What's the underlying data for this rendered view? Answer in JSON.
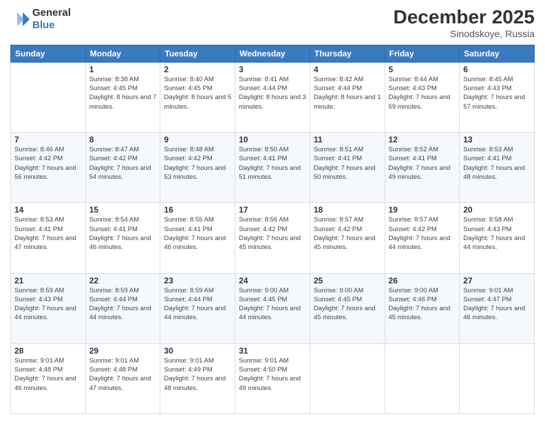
{
  "logo": {
    "general": "General",
    "blue": "Blue"
  },
  "title": "December 2025",
  "location": "Sinodskoye, Russia",
  "weekdays": [
    "Sunday",
    "Monday",
    "Tuesday",
    "Wednesday",
    "Thursday",
    "Friday",
    "Saturday"
  ],
  "weeks": [
    [
      {
        "day": "",
        "sunrise": "",
        "sunset": "",
        "daylight": ""
      },
      {
        "day": "1",
        "sunrise": "Sunrise: 8:38 AM",
        "sunset": "Sunset: 4:45 PM",
        "daylight": "Daylight: 8 hours and 7 minutes."
      },
      {
        "day": "2",
        "sunrise": "Sunrise: 8:40 AM",
        "sunset": "Sunset: 4:45 PM",
        "daylight": "Daylight: 8 hours and 5 minutes."
      },
      {
        "day": "3",
        "sunrise": "Sunrise: 8:41 AM",
        "sunset": "Sunset: 4:44 PM",
        "daylight": "Daylight: 8 hours and 3 minutes."
      },
      {
        "day": "4",
        "sunrise": "Sunrise: 8:42 AM",
        "sunset": "Sunset: 4:44 PM",
        "daylight": "Daylight: 8 hours and 1 minute."
      },
      {
        "day": "5",
        "sunrise": "Sunrise: 8:44 AM",
        "sunset": "Sunset: 4:43 PM",
        "daylight": "Daylight: 7 hours and 59 minutes."
      },
      {
        "day": "6",
        "sunrise": "Sunrise: 8:45 AM",
        "sunset": "Sunset: 4:43 PM",
        "daylight": "Daylight: 7 hours and 57 minutes."
      }
    ],
    [
      {
        "day": "7",
        "sunrise": "Sunrise: 8:46 AM",
        "sunset": "Sunset: 4:42 PM",
        "daylight": "Daylight: 7 hours and 56 minutes."
      },
      {
        "day": "8",
        "sunrise": "Sunrise: 8:47 AM",
        "sunset": "Sunset: 4:42 PM",
        "daylight": "Daylight: 7 hours and 54 minutes."
      },
      {
        "day": "9",
        "sunrise": "Sunrise: 8:48 AM",
        "sunset": "Sunset: 4:42 PM",
        "daylight": "Daylight: 7 hours and 53 minutes."
      },
      {
        "day": "10",
        "sunrise": "Sunrise: 8:50 AM",
        "sunset": "Sunset: 4:41 PM",
        "daylight": "Daylight: 7 hours and 51 minutes."
      },
      {
        "day": "11",
        "sunrise": "Sunrise: 8:51 AM",
        "sunset": "Sunset: 4:41 PM",
        "daylight": "Daylight: 7 hours and 50 minutes."
      },
      {
        "day": "12",
        "sunrise": "Sunrise: 8:52 AM",
        "sunset": "Sunset: 4:41 PM",
        "daylight": "Daylight: 7 hours and 49 minutes."
      },
      {
        "day": "13",
        "sunrise": "Sunrise: 8:53 AM",
        "sunset": "Sunset: 4:41 PM",
        "daylight": "Daylight: 7 hours and 48 minutes."
      }
    ],
    [
      {
        "day": "14",
        "sunrise": "Sunrise: 8:53 AM",
        "sunset": "Sunset: 4:41 PM",
        "daylight": "Daylight: 7 hours and 47 minutes."
      },
      {
        "day": "15",
        "sunrise": "Sunrise: 8:54 AM",
        "sunset": "Sunset: 4:41 PM",
        "daylight": "Daylight: 7 hours and 46 minutes."
      },
      {
        "day": "16",
        "sunrise": "Sunrise: 8:55 AM",
        "sunset": "Sunset: 4:41 PM",
        "daylight": "Daylight: 7 hours and 46 minutes."
      },
      {
        "day": "17",
        "sunrise": "Sunrise: 8:56 AM",
        "sunset": "Sunset: 4:42 PM",
        "daylight": "Daylight: 7 hours and 45 minutes."
      },
      {
        "day": "18",
        "sunrise": "Sunrise: 8:57 AM",
        "sunset": "Sunset: 4:42 PM",
        "daylight": "Daylight: 7 hours and 45 minutes."
      },
      {
        "day": "19",
        "sunrise": "Sunrise: 8:57 AM",
        "sunset": "Sunset: 4:42 PM",
        "daylight": "Daylight: 7 hours and 44 minutes."
      },
      {
        "day": "20",
        "sunrise": "Sunrise: 8:58 AM",
        "sunset": "Sunset: 4:43 PM",
        "daylight": "Daylight: 7 hours and 44 minutes."
      }
    ],
    [
      {
        "day": "21",
        "sunrise": "Sunrise: 8:59 AM",
        "sunset": "Sunset: 4:43 PM",
        "daylight": "Daylight: 7 hours and 44 minutes."
      },
      {
        "day": "22",
        "sunrise": "Sunrise: 8:59 AM",
        "sunset": "Sunset: 4:44 PM",
        "daylight": "Daylight: 7 hours and 44 minutes."
      },
      {
        "day": "23",
        "sunrise": "Sunrise: 8:59 AM",
        "sunset": "Sunset: 4:44 PM",
        "daylight": "Daylight: 7 hours and 44 minutes."
      },
      {
        "day": "24",
        "sunrise": "Sunrise: 9:00 AM",
        "sunset": "Sunset: 4:45 PM",
        "daylight": "Daylight: 7 hours and 44 minutes."
      },
      {
        "day": "25",
        "sunrise": "Sunrise: 9:00 AM",
        "sunset": "Sunset: 4:45 PM",
        "daylight": "Daylight: 7 hours and 45 minutes."
      },
      {
        "day": "26",
        "sunrise": "Sunrise: 9:00 AM",
        "sunset": "Sunset: 4:46 PM",
        "daylight": "Daylight: 7 hours and 45 minutes."
      },
      {
        "day": "27",
        "sunrise": "Sunrise: 9:01 AM",
        "sunset": "Sunset: 4:47 PM",
        "daylight": "Daylight: 7 hours and 46 minutes."
      }
    ],
    [
      {
        "day": "28",
        "sunrise": "Sunrise: 9:01 AM",
        "sunset": "Sunset: 4:48 PM",
        "daylight": "Daylight: 7 hours and 46 minutes."
      },
      {
        "day": "29",
        "sunrise": "Sunrise: 9:01 AM",
        "sunset": "Sunset: 4:48 PM",
        "daylight": "Daylight: 7 hours and 47 minutes."
      },
      {
        "day": "30",
        "sunrise": "Sunrise: 9:01 AM",
        "sunset": "Sunset: 4:49 PM",
        "daylight": "Daylight: 7 hours and 48 minutes."
      },
      {
        "day": "31",
        "sunrise": "Sunrise: 9:01 AM",
        "sunset": "Sunset: 4:50 PM",
        "daylight": "Daylight: 7 hours and 49 minutes."
      },
      {
        "day": "",
        "sunrise": "",
        "sunset": "",
        "daylight": ""
      },
      {
        "day": "",
        "sunrise": "",
        "sunset": "",
        "daylight": ""
      },
      {
        "day": "",
        "sunrise": "",
        "sunset": "",
        "daylight": ""
      }
    ]
  ]
}
